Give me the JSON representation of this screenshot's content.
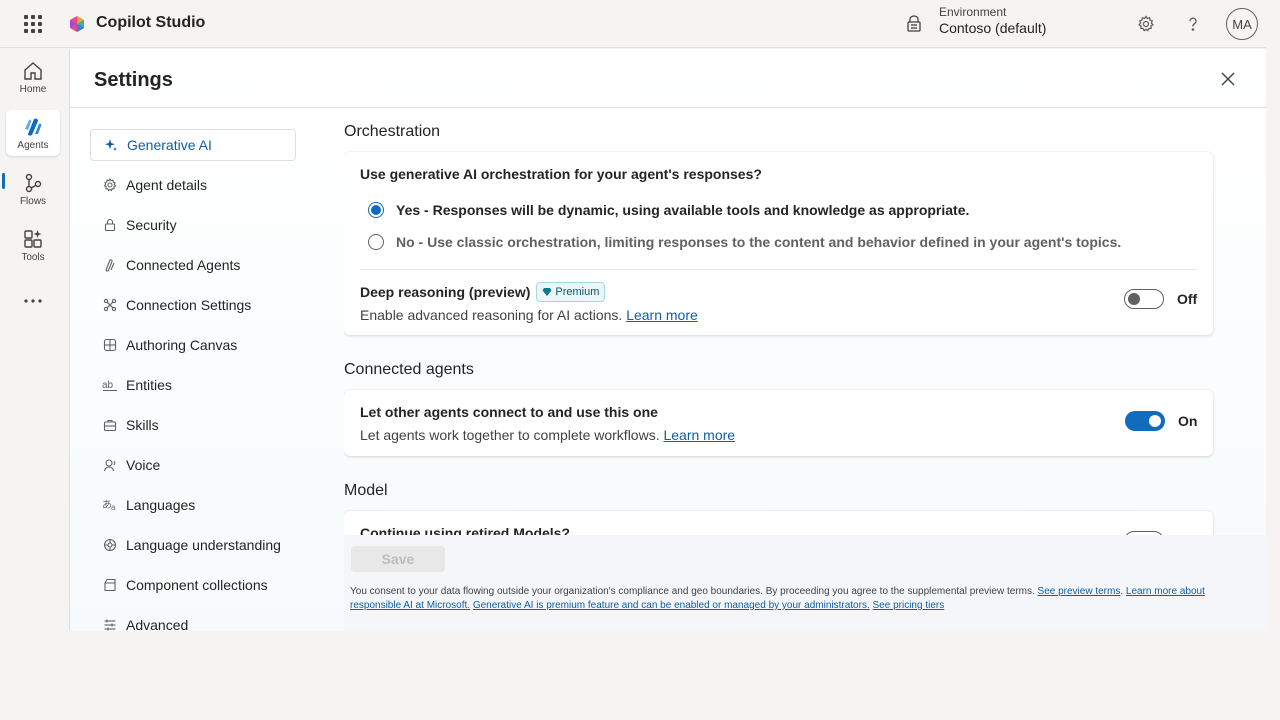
{
  "app": {
    "title": "Copilot Studio"
  },
  "environment": {
    "label": "Environment",
    "value": "Contoso (default)"
  },
  "user": {
    "initials": "MA"
  },
  "rail": [
    {
      "label": "Home",
      "icon": "home-icon"
    },
    {
      "label": "Agents",
      "icon": "agents-icon",
      "active": true
    },
    {
      "label": "Flows",
      "icon": "flows-icon"
    },
    {
      "label": "Tools",
      "icon": "tools-icon"
    }
  ],
  "settings": {
    "title": "Settings",
    "nav": [
      {
        "label": "Generative AI",
        "icon": "sparkle-icon",
        "active": true
      },
      {
        "label": "Agent details",
        "icon": "gear-icon"
      },
      {
        "label": "Security",
        "icon": "lock-icon"
      },
      {
        "label": "Connected Agents",
        "icon": "connected-agents-icon"
      },
      {
        "label": "Connection Settings",
        "icon": "connection-icon"
      },
      {
        "label": "Authoring Canvas",
        "icon": "canvas-icon"
      },
      {
        "label": "Entities",
        "icon": "entities-icon"
      },
      {
        "label": "Skills",
        "icon": "skills-icon"
      },
      {
        "label": "Voice",
        "icon": "voice-icon"
      },
      {
        "label": "Languages",
        "icon": "languages-icon"
      },
      {
        "label": "Language understanding",
        "icon": "brain-icon"
      },
      {
        "label": "Component collections",
        "icon": "collection-icon"
      },
      {
        "label": "Advanced",
        "icon": "sliders-icon"
      }
    ]
  },
  "orchestration": {
    "section_title": "Orchestration",
    "question": "Use generative AI orchestration for your agent's responses?",
    "options": [
      {
        "label": "Yes - Responses will be dynamic, using available tools and knowledge as appropriate.",
        "checked": true
      },
      {
        "label": "No - Use classic orchestration, limiting responses to the content and behavior defined in your agent's topics.",
        "checked": false
      }
    ],
    "deep_reasoning": {
      "title": "Deep reasoning (preview)",
      "badge": "Premium",
      "description": "Enable advanced reasoning for AI actions.",
      "link": "Learn more",
      "toggle_state": "Off"
    }
  },
  "connected_agents": {
    "section_title": "Connected agents",
    "title": "Let other agents connect to and use this one",
    "description": "Let agents work together to complete workflows.",
    "link": "Learn more",
    "toggle_state": "On"
  },
  "model": {
    "section_title": "Model",
    "title": "Continue using retired Models?"
  },
  "footer": {
    "save_label": "Save",
    "consent_text": "You consent to your data flowing outside your organization's compliance and geo boundaries. By proceeding you agree to the supplemental preview terms.",
    "link_preview_terms": "See preview terms",
    "link_responsible_ai": "Learn more about responsible AI at Microsoft.",
    "link_premium": "Generative AI is premium feature and can be enabled or managed by your administrators.",
    "link_pricing": "See pricing tiers"
  },
  "colors": {
    "accent": "#0f6cbd",
    "link": "#115ea3",
    "badge_bg": "#ebf6f8"
  }
}
